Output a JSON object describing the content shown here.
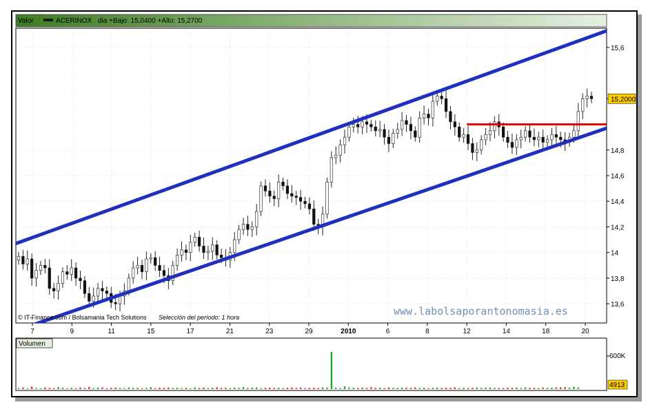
{
  "header": {
    "series_label": "Valor",
    "ticker": "ACERINOX",
    "stats": "dia +Bajo: 15,0400 +Alto: 15,2700"
  },
  "credit": {
    "source": "© IT-Finance.com / Bolsamania Tech Solutions",
    "period": "Selección del período: 1 hora"
  },
  "watermark": "www.labolsaporantonomasia.es",
  "volume_panel": {
    "label": "Volumen",
    "tick": "600K",
    "last_value": "4913"
  },
  "colors": {
    "header_start": "#3d7c22",
    "header_end": "#e6f0e0",
    "up": "#22aa22",
    "down": "#dd3333",
    "channel": "#1f2fbf",
    "resistance": "#dd0000",
    "price_tag": "#ffcc00",
    "grid": "#c8c8c8"
  },
  "chart_data": [
    {
      "type": "candlestick",
      "title": "ACERINOX",
      "interval": "1 hora",
      "x_ticks": [
        "7",
        "9",
        "11",
        "15",
        "17",
        "21",
        "23",
        "29",
        "2010",
        "6",
        "8",
        "12",
        "14",
        "18",
        "20"
      ],
      "y_ticks": [
        "13,6",
        "13,8",
        "14",
        "14,2",
        "14,4",
        "14,6",
        "14,8",
        "15,2000",
        "15,6"
      ],
      "ylim": [
        13.45,
        15.75
      ],
      "last_price": 15.2,
      "series_close": [
        13.97,
        13.91,
        13.95,
        13.8,
        13.86,
        13.9,
        13.88,
        13.72,
        13.7,
        13.76,
        13.85,
        13.83,
        13.88,
        13.8,
        13.78,
        13.68,
        13.62,
        13.66,
        13.72,
        13.7,
        13.68,
        13.61,
        13.6,
        13.66,
        13.7,
        13.8,
        13.88,
        13.9,
        13.85,
        13.95,
        13.96,
        13.9,
        13.86,
        13.82,
        13.78,
        13.9,
        13.98,
        14.02,
        14.0,
        14.08,
        14.12,
        14.05,
        14.0,
        14.01,
        14.06,
        13.98,
        13.96,
        13.94,
        14.0,
        14.1,
        14.18,
        14.22,
        14.18,
        14.2,
        14.32,
        14.52,
        14.48,
        14.44,
        14.42,
        14.55,
        14.52,
        14.46,
        14.44,
        14.43,
        14.4,
        14.38,
        14.34,
        14.22,
        14.2,
        14.3,
        14.55,
        14.74,
        14.76,
        14.84,
        14.9,
        14.98,
        15.0,
        14.98,
        15.02,
        15.0,
        14.98,
        14.95,
        14.96,
        14.9,
        14.85,
        14.93,
        14.96,
        15.03,
        15.0,
        14.95,
        14.9,
        15.05,
        15.08,
        15.05,
        15.18,
        15.22,
        15.2,
        15.1,
        15.02,
        14.98,
        14.9,
        14.92,
        14.85,
        14.78,
        14.8,
        14.88,
        14.92,
        14.95,
        15.02,
        14.98,
        14.9,
        14.86,
        14.82,
        14.88,
        14.9,
        14.95,
        14.9,
        14.88,
        14.9,
        14.86,
        14.88,
        14.92,
        14.9,
        14.88,
        14.86,
        14.9,
        14.95,
        15.1,
        15.2,
        15.22,
        15.2
      ],
      "volume": [
        40,
        55,
        25,
        90,
        40,
        30,
        60,
        45,
        35,
        70,
        50,
        30,
        45,
        25,
        60,
        40,
        80,
        35,
        50,
        65,
        30,
        45,
        55,
        40,
        35,
        60,
        45,
        50,
        30,
        40,
        70,
        35,
        55,
        45,
        60,
        40,
        50,
        35,
        45,
        30,
        60,
        40,
        55,
        35,
        45,
        65,
        40,
        50,
        35,
        55,
        45,
        70,
        40,
        50,
        60,
        35,
        45,
        55,
        40,
        50,
        35,
        45,
        60,
        40,
        55,
        35,
        45,
        50,
        40,
        60,
        55,
        45,
        50,
        40,
        95,
        60,
        50,
        45,
        55,
        40,
        70,
        45,
        50,
        35,
        60,
        45,
        40,
        55,
        50,
        45,
        60,
        40,
        50,
        35,
        45,
        55,
        40,
        50,
        45,
        60,
        35,
        50,
        40,
        45,
        55,
        40,
        50,
        60,
        45,
        40,
        35,
        50,
        45,
        55,
        40,
        60,
        45,
        50,
        40,
        55,
        45,
        50,
        60,
        65,
        70,
        55,
        85,
        60
      ],
      "volume_spike_index": 71,
      "volume_spike": 600000,
      "overlays": [
        {
          "name": "upper_channel",
          "x": [
            0,
            1
          ],
          "y": [
            14.07,
            15.73
          ]
        },
        {
          "name": "lower_channel",
          "x": [
            0,
            1
          ],
          "y": [
            13.39,
            14.97
          ]
        },
        {
          "name": "resistance",
          "x": [
            0.765,
            1
          ],
          "y": [
            15.0,
            15.0
          ]
        }
      ]
    }
  ]
}
